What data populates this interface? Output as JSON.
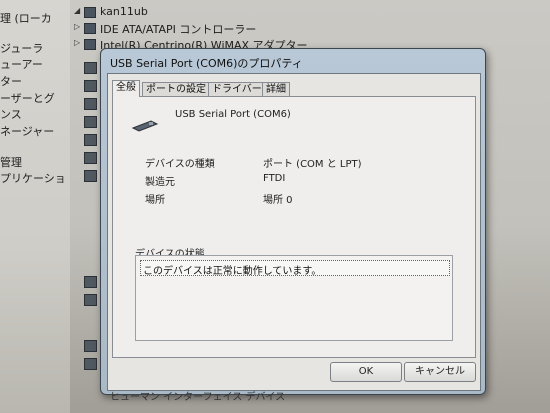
{
  "left_panel": {
    "items": [
      "理 (ローカ",
      "ジューラ",
      "ューアー",
      "ター",
      "ーザーとグ",
      "ンス",
      "ネージャー",
      "管理",
      "プリケーショ"
    ]
  },
  "tree": {
    "root": "kan11ub",
    "items": [
      "IDE ATA/ATAPI コントローラー",
      "Intel(R) Centrino(R) WiMAX アダプター"
    ]
  },
  "dialog": {
    "title": "USB Serial Port (COM6)のプロパティ",
    "tabs": [
      "全般",
      "ポートの設定",
      "ドライバー",
      "詳細"
    ],
    "device_name": "USB Serial Port (COM6)",
    "properties": [
      {
        "label": "デバイスの種類",
        "value": "ポート (COM と LPT)"
      },
      {
        "label": "製造元",
        "value": "FTDI"
      },
      {
        "label": "場所",
        "value": "場所 0"
      }
    ],
    "status_label": "デバイスの状態",
    "status_text": "このデバイスは正常に動作しています。",
    "ok_label": "OK",
    "cancel_label": "キャンセル"
  },
  "bottom_caption": "ヒューマン インターフェイス デバイス"
}
